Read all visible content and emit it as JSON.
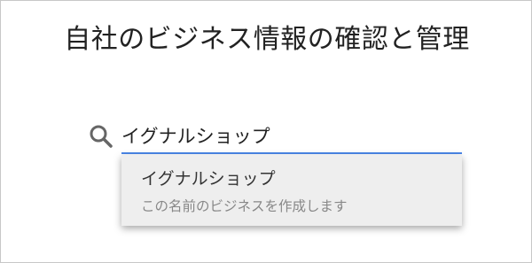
{
  "page": {
    "title": "自社のビジネス情報の確認と管理"
  },
  "search": {
    "value": "イグナルショップ",
    "icon": "search-icon",
    "underline_color": "#4a86e8"
  },
  "suggestion": {
    "name": "イグナルショップ",
    "description": "この名前のビジネスを作成します"
  }
}
